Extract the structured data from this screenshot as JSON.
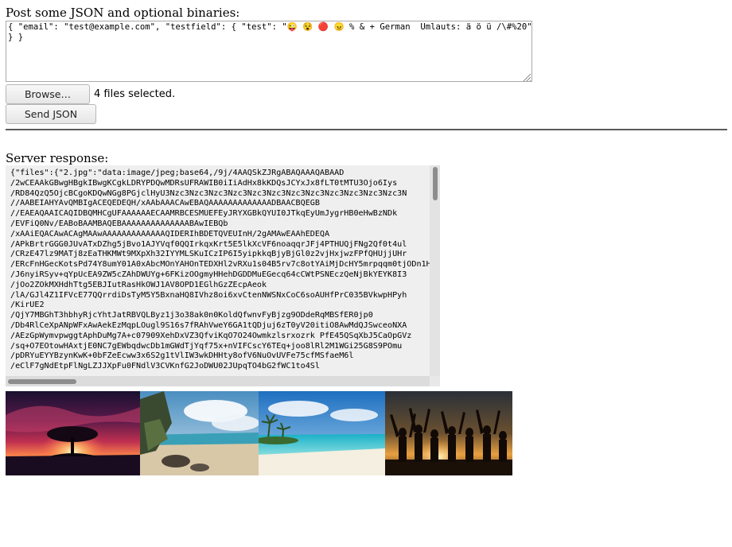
{
  "page": {
    "title": "Post some JSON and optional binaries:"
  },
  "json_input": {
    "value": "{ \"email\": \"test@example.com\", \"testfield\": { \"test\": \"😜 😵 🔴 😠 % & + German  Umlauts: ä ö ü /\\#%20\"\n} }"
  },
  "file_input": {
    "browse_label": "Browse…",
    "status": "4 files selected."
  },
  "send_button_label": "Send JSON",
  "response": {
    "label": "Server response:",
    "lines": [
      "{\"files\":{\"2.jpg\":\"data:image/jpeg;base64,/9j/4AAQSkZJRgABAQAAAQABAAD",
      "/2wCEAAkGBwgHBgkIBwgKCgkLDRYPDQwMDRsUFRAWIB0iIiAdHx8kKDQsJCYxJx8fLT0tMTU3Ojo6Iys",
      "/RD84QzQ5OjcBCgoKDQwNGg8PGjclHyU3Nzc3Nzc3Nzc3Nzc3Nzc3Nzc3Nzc3Nzc3Nzc3Nzc3Nzc3Nzc3N",
      "//AABEIAHYAvQMBIgACEQEDEQH/xAAbAAACAwEBAQAAAAAAAAAAAAADBAACBQEGB",
      "//EAEAQAAICAQIDBQMHCgUFAAAAAAECAAMRBCESMUEFEyJRYXGBkQYUI0JTkqEyUmJygrHB0eHwBzNDk",
      "/EVFiQ0Nv/EABoBAAMBAQEBAAAAAAAAAAAAAABAwIEBQb",
      "/xAAiEQACAwACAgMAAwAAAAAAAAAAAAAQIDERIhBDETQVEUInH/2gAMAwEAAhEDEQA",
      "/APkBrtrGGG0JUvATxDZhg5jBvo1AJYVqf0QQIrkqxKrt5E5lkXcVF6noaqqrJFj4PTHUQjFNg2Qf0t4ul",
      "/CRzE47lz9MATj8zEaTHKMWt9MXpXh32IYYMLSKuICzIP6I5yipkkqBjyBjGl0z2vjHxjwzFPfQHUjjUHr",
      "/ERcFnHGecKotsPd74Y8umY01A0xAbcMOnYAHOnTEDXHl2vRXu1s04B5rv7c8otYAiMjDcHY5mrpqqm0tjODn1H",
      "/J6nyiRSyv+qYpUcEA9ZW5cZAhDWUYg+6FKizOOgmyHHehDGDDMuEGecq64cCWtPSNEczQeNjBkYEYK8I3",
      "/jOo2ZOkMXHdhTtg5EBJIutRasHkOWJ1AV8OPD1EGlhGzZEcpAeok",
      "/lA/GJl4Z1IFVcE77QQrrdiDsTyM5Y5BxnaHQ8IVhz8oi6xvCtenNWSNxCoC6soAUHfPrC035BVkwpHPyh",
      "/KirUE2",
      "/QjY7MBGhT3hbhyRjcYhtJatRBVQLByz1j3o38ak0n0KoldQfwnvFyBjzg9ODdeRqMBSfER0jp0",
      "/Db4RlCeXpANpWFxAwAekEzMqpLOugl9S16s7fRAhVweY6GA1tQDjuj6zT0yV20itiO8AwMdQJSwceoNXA",
      "/AEzGpWymvpwggtAphDuMg7A+c07909XehDxVZ3QfviKqO7O24Owmkzlsrxozrk PfE45QSqXbJ5CaOpGVz",
      "/sq+O7EOtowHAxtjE0NC7gEWbqdwcDb1mGWdTjYqf75x+nVIFCscY6TEq+joo8lRl2M1WGi25G8S9POmu",
      "/pDRYuEYYBzynKwK+0bFZeEcww3x6S2g1tVlIW3wkDHHty8ofV6NuOvUVFe75cfMSfaeM6l",
      "/eClF7gNdEtpFlNgLZJJXpFu0FNdlV3CVKnfG2JoDWU02JUpqTO4bG2fWC1to4Sl"
    ]
  },
  "images": [
    {
      "name": "tree-sunset-photo"
    },
    {
      "name": "beach-rocks-photo"
    },
    {
      "name": "tropical-beach-photo"
    },
    {
      "name": "group-silhouette-sunset-photo"
    }
  ]
}
